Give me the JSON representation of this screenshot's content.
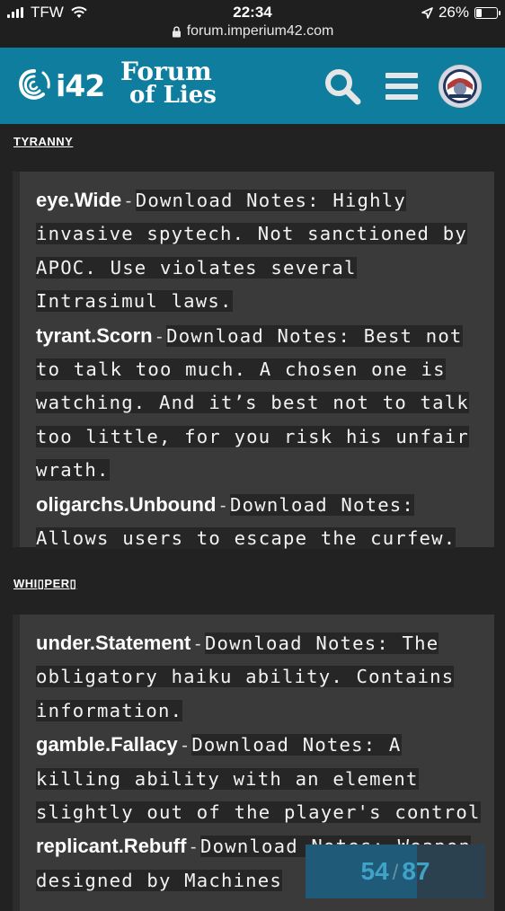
{
  "status_bar": {
    "carrier": "TFW",
    "time": "22:34",
    "battery": "26%",
    "battery_level": 0.26,
    "url": "forum.imperium42.com"
  },
  "header": {
    "logo_text": "i42",
    "forum_logo_line1": "Forum",
    "forum_logo_line2": "of Lies",
    "search_icon": "search-icon",
    "menu_icon": "menu-icon"
  },
  "sections": [
    {
      "category": "TYRANNY",
      "entries": [
        {
          "name": "eye.Wide",
          "note": "Download Notes: Highly invasive spytech. Not sanctioned by APOC. Use violates several Intrasimul laws."
        },
        {
          "name": "tyrant.Scorn",
          "note": "Download Notes: Best not to talk too much. A chosen one is watching. And it’s best not to talk too little, for you risk his unfair wrath."
        },
        {
          "name": "oligarchs.Unbound",
          "note": "Download Notes: Allows users to escape the curfew."
        }
      ]
    },
    {
      "category": "WHI▯PER▯",
      "entries": [
        {
          "name": "under.Statement",
          "note": "Download Notes: The obligatory haiku ability. Contains information."
        },
        {
          "name": "gamble.Fallacy",
          "note": "Download Notes: A killing ability with an element slightly out of the player's control"
        },
        {
          "name": "replicant.Rebuff",
          "note": "Download Notes: Weapon designed by Machines"
        }
      ]
    }
  ],
  "separator": "-",
  "progress": {
    "current": "54",
    "sep": "/",
    "total": "87",
    "fraction": 0.62
  },
  "colors": {
    "header_bg": "#0f7e9e",
    "page_bg": "#222222",
    "panel_bg": "#3a3a3a",
    "progress_text": "#3fa3c8"
  }
}
